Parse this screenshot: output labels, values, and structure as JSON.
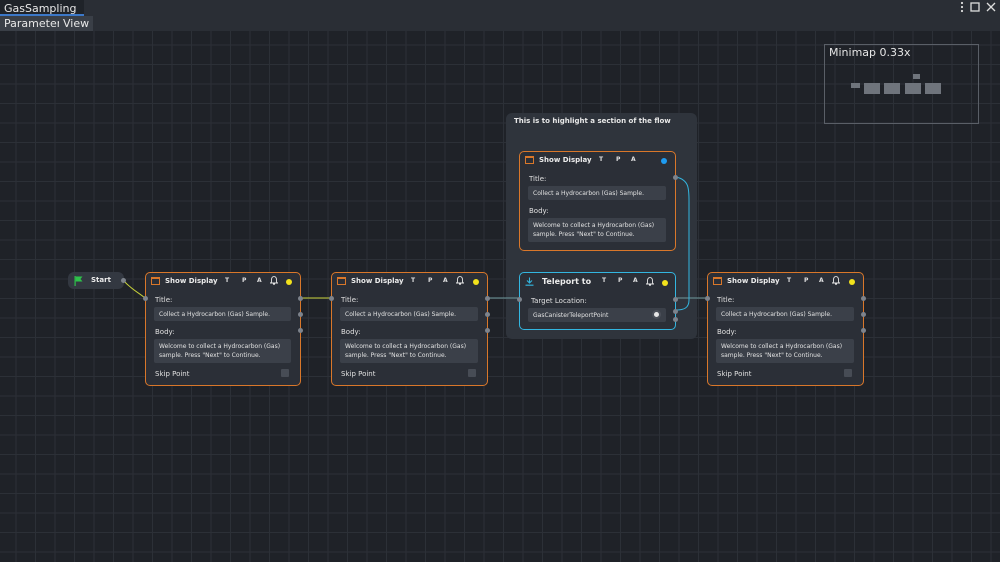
{
  "window": {
    "tab_title": "GasSampling"
  },
  "menubar": {
    "items": [
      "Parameters",
      "View"
    ]
  },
  "minimap": {
    "label": "Minimap 0.33x"
  },
  "group": {
    "title": "This is to highlight a section of the flow"
  },
  "start_node": {
    "label": "Start"
  },
  "nodes": {
    "show1": {
      "title": "Show Display",
      "t": "T",
      "p": "P",
      "a": "A",
      "title_label": "Title:",
      "title_value": "Collect a Hydrocarbon (Gas) Sample.",
      "body_label": "Body:",
      "body_value": "Welcome to collect a Hydrocarbon (Gas) sample. Press \"Next\" to Continue.",
      "skip_label": "Skip Point"
    },
    "show2": {
      "title": "Show Display",
      "t": "T",
      "p": "P",
      "a": "A",
      "title_label": "Title:",
      "title_value": "Collect a Hydrocarbon (Gas) Sample.",
      "body_label": "Body:",
      "body_value": "Welcome to collect a Hydrocarbon (Gas) sample. Press \"Next\" to Continue.",
      "skip_label": "Skip Point"
    },
    "show_group": {
      "title": "Show Display",
      "t": "T",
      "p": "P",
      "a": "A",
      "title_label": "Title:",
      "title_value": "Collect a Hydrocarbon (Gas) Sample.",
      "body_label": "Body:",
      "body_value": "Welcome to collect a Hydrocarbon (Gas) sample. Press \"Next\" to Continue."
    },
    "teleport": {
      "title": "Teleport to",
      "t": "T",
      "p": "P",
      "a": "A",
      "target_label": "Target Location:",
      "target_value": "GasCanisterTeleportPoint"
    },
    "show3": {
      "title": "Show Display",
      "t": "T",
      "p": "P",
      "a": "A",
      "title_label": "Title:",
      "title_value": "Collect a Hydrocarbon (Gas) Sample.",
      "body_label": "Body:",
      "body_value": "Welcome to collect a Hydrocarbon (Gas) sample. Press \"Next\" to Continue.",
      "skip_label": "Skip Point"
    }
  },
  "colors": {
    "accent_orange": "#d9772a",
    "accent_cyan": "#33b6e0",
    "status_yellow": "#f2e21c",
    "status_blue": "#1e9bf0",
    "wire_yellow": "#c8d23a"
  },
  "icons": {
    "flag": "flag-icon",
    "display": "window-icon",
    "teleport": "download-arrow-icon",
    "bell": "bell-icon"
  }
}
